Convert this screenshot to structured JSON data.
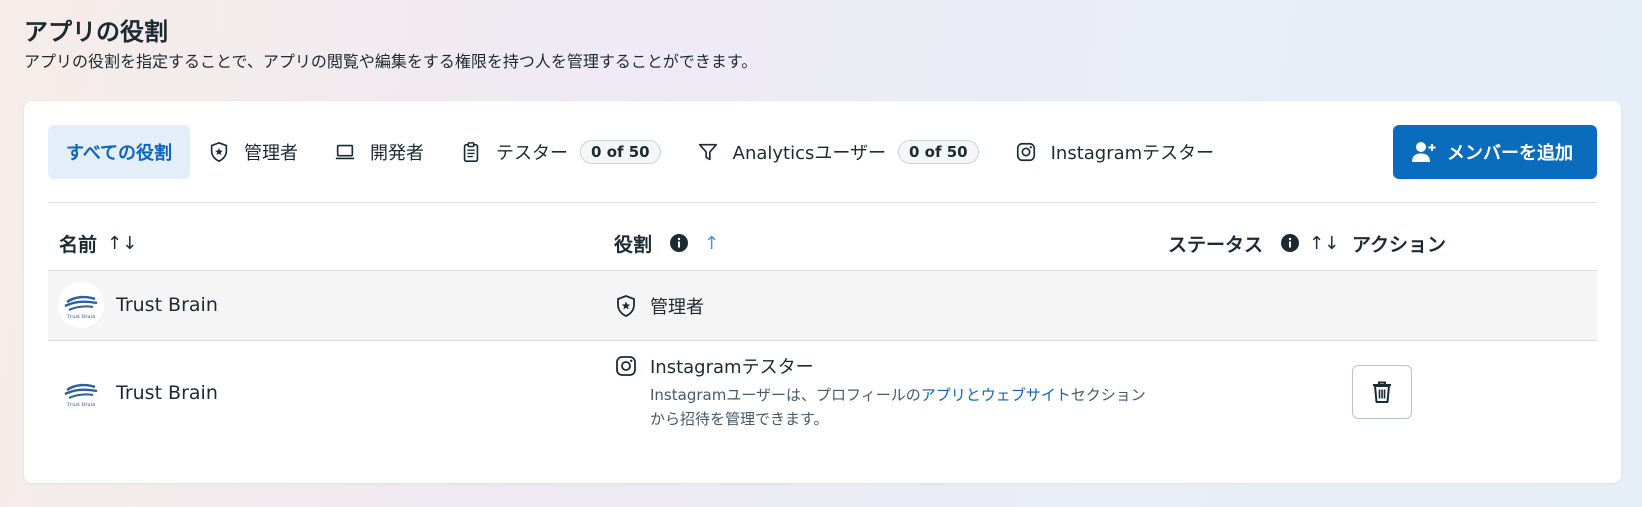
{
  "header": {
    "title": "アプリの役割",
    "subtitle": "アプリの役割を指定することで、アプリの閲覧や編集をする権限を持つ人を管理することができます。"
  },
  "tabs": [
    {
      "label": "すべての役割",
      "icon": "none",
      "active": true
    },
    {
      "label": "管理者",
      "icon": "shield-star-icon"
    },
    {
      "label": "開発者",
      "icon": "laptop-icon"
    },
    {
      "label": "テスター",
      "icon": "clipboard-icon",
      "badge": "0 of 50"
    },
    {
      "label": "Analyticsユーザー",
      "icon": "funnel-icon",
      "badge": "0 of 50"
    },
    {
      "label": "Instagramテスター",
      "icon": "instagram-icon"
    }
  ],
  "add_button": {
    "label": "メンバーを追加",
    "icon": "add-person-icon"
  },
  "table": {
    "columns": {
      "name": "名前",
      "role": "役割",
      "status": "ステータス",
      "action": "アクション"
    },
    "sort_glyph": "↑↓",
    "sort_active_glyph": "↑",
    "rows": [
      {
        "name": "Trust Brain",
        "avatar": "Trust Brain",
        "role": "管理者",
        "role_icon": "shield-star-icon"
      },
      {
        "name": "Trust Brain",
        "avatar": "Trust Brain",
        "role": "Instagramテスター",
        "role_icon": "instagram-icon",
        "desc_before": "Instagramユーザーは、プロフィールの",
        "desc_link": "アプリとウェブサイト",
        "desc_after": "セクションから招待を管理できます。",
        "action_icon": "trash-icon"
      }
    ]
  },
  "colors": {
    "accent": "#0a6cbd",
    "active_tab_bg": "#e4eef8",
    "link": "#0a66c2"
  }
}
